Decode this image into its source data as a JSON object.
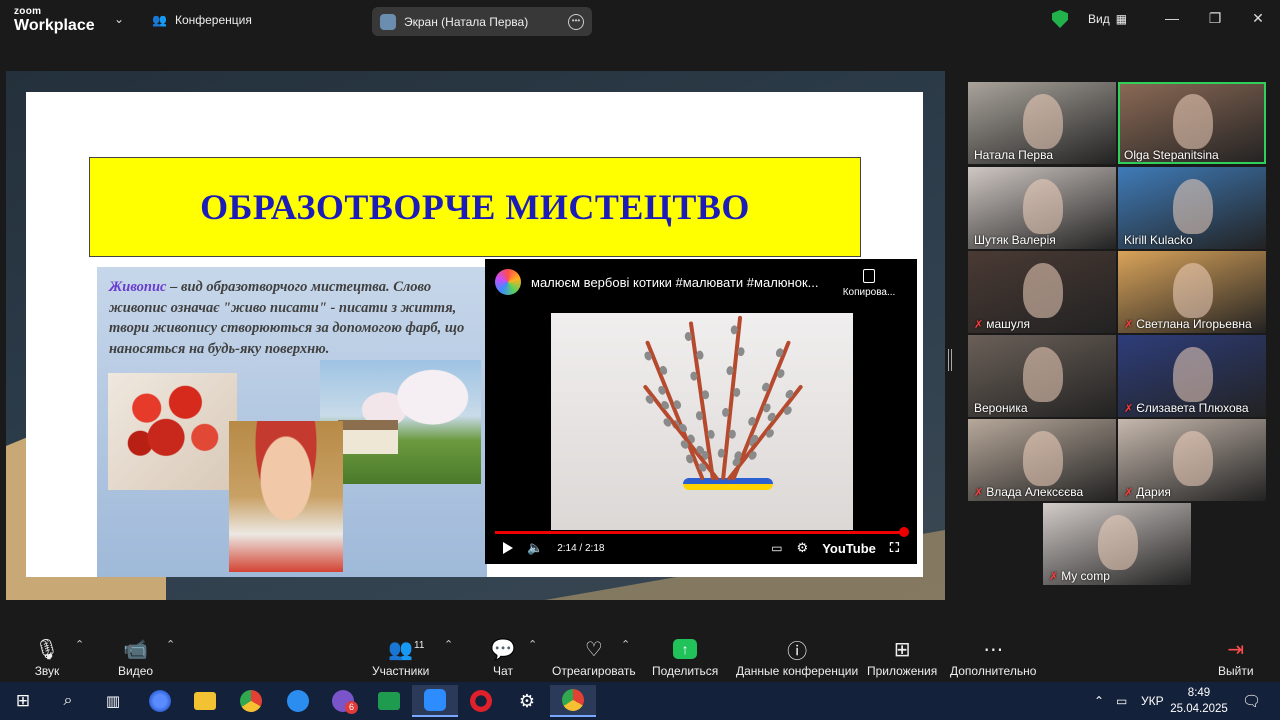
{
  "titlebar": {
    "brand_small": "zoom",
    "brand_big": "Workplace",
    "conference_label": "Конференция",
    "screen_share_label": "Экран (Натала Перва)",
    "view_label": "Вид"
  },
  "slide": {
    "title": "ОБРАЗОТВОРЧЕ МИСТЕЦТВО",
    "keyword": "Живопис",
    "body": " – вид образотворчого мистецтва. Слово живопис означає \"живо писати\" - писати з життя, твори живопису створюються за допомогою фарб, що наносяться на будь-яку поверхню."
  },
  "video": {
    "title": "малюєм вербові котики #малювати #малюнок...",
    "copy_label": "Копирова...",
    "time": "2:14 / 2:18",
    "progress": 0.97,
    "brand": "YouTube"
  },
  "gallery": [
    {
      "name": "Натала Перва",
      "muted": false,
      "active": false,
      "color": "#a9a39b"
    },
    {
      "name": "Olga Stepanitsina",
      "muted": false,
      "active": true,
      "color": "#8c6a56"
    },
    {
      "name": "Шутяк Валерія",
      "muted": false,
      "active": false,
      "color": "#cfc7c3"
    },
    {
      "name": "Kirill Kulacko",
      "muted": false,
      "active": false,
      "color": "#3f7bb8"
    },
    {
      "name": "машуля",
      "muted": true,
      "active": false,
      "color": "#4a3a34"
    },
    {
      "name": "Светлана Игорьевна",
      "muted": true,
      "active": false,
      "color": "#d9a35a"
    },
    {
      "name": "Вероника",
      "muted": false,
      "active": false,
      "color": "#6b6058"
    },
    {
      "name": "Єлизавета Плюхова",
      "muted": true,
      "active": false,
      "color": "#2d3d7a"
    },
    {
      "name": "Влада Алексєєва",
      "muted": true,
      "active": false,
      "color": "#b7a89a"
    },
    {
      "name": "Дария",
      "muted": true,
      "active": false,
      "color": "#c6b8ad"
    },
    {
      "name": "My comp",
      "muted": true,
      "active": false,
      "color": "#d3ccc9"
    }
  ],
  "toolbar": {
    "audio": "Звук",
    "video": "Видео",
    "participants": "Участники",
    "participants_count": "11",
    "chat": "Чат",
    "react": "Отреагировать",
    "share": "Поделиться",
    "info": "Данные конференции",
    "apps": "Приложения",
    "more": "Дополнительно",
    "leave": "Выйти"
  },
  "taskbar": {
    "viber_badge": "6",
    "lang": "УКР",
    "time": "8:49",
    "date": "25.04.2025"
  },
  "colors": {
    "accent_green": "#22c25a",
    "slide_title": "#1c1cb8",
    "banner": "#ffff00"
  }
}
